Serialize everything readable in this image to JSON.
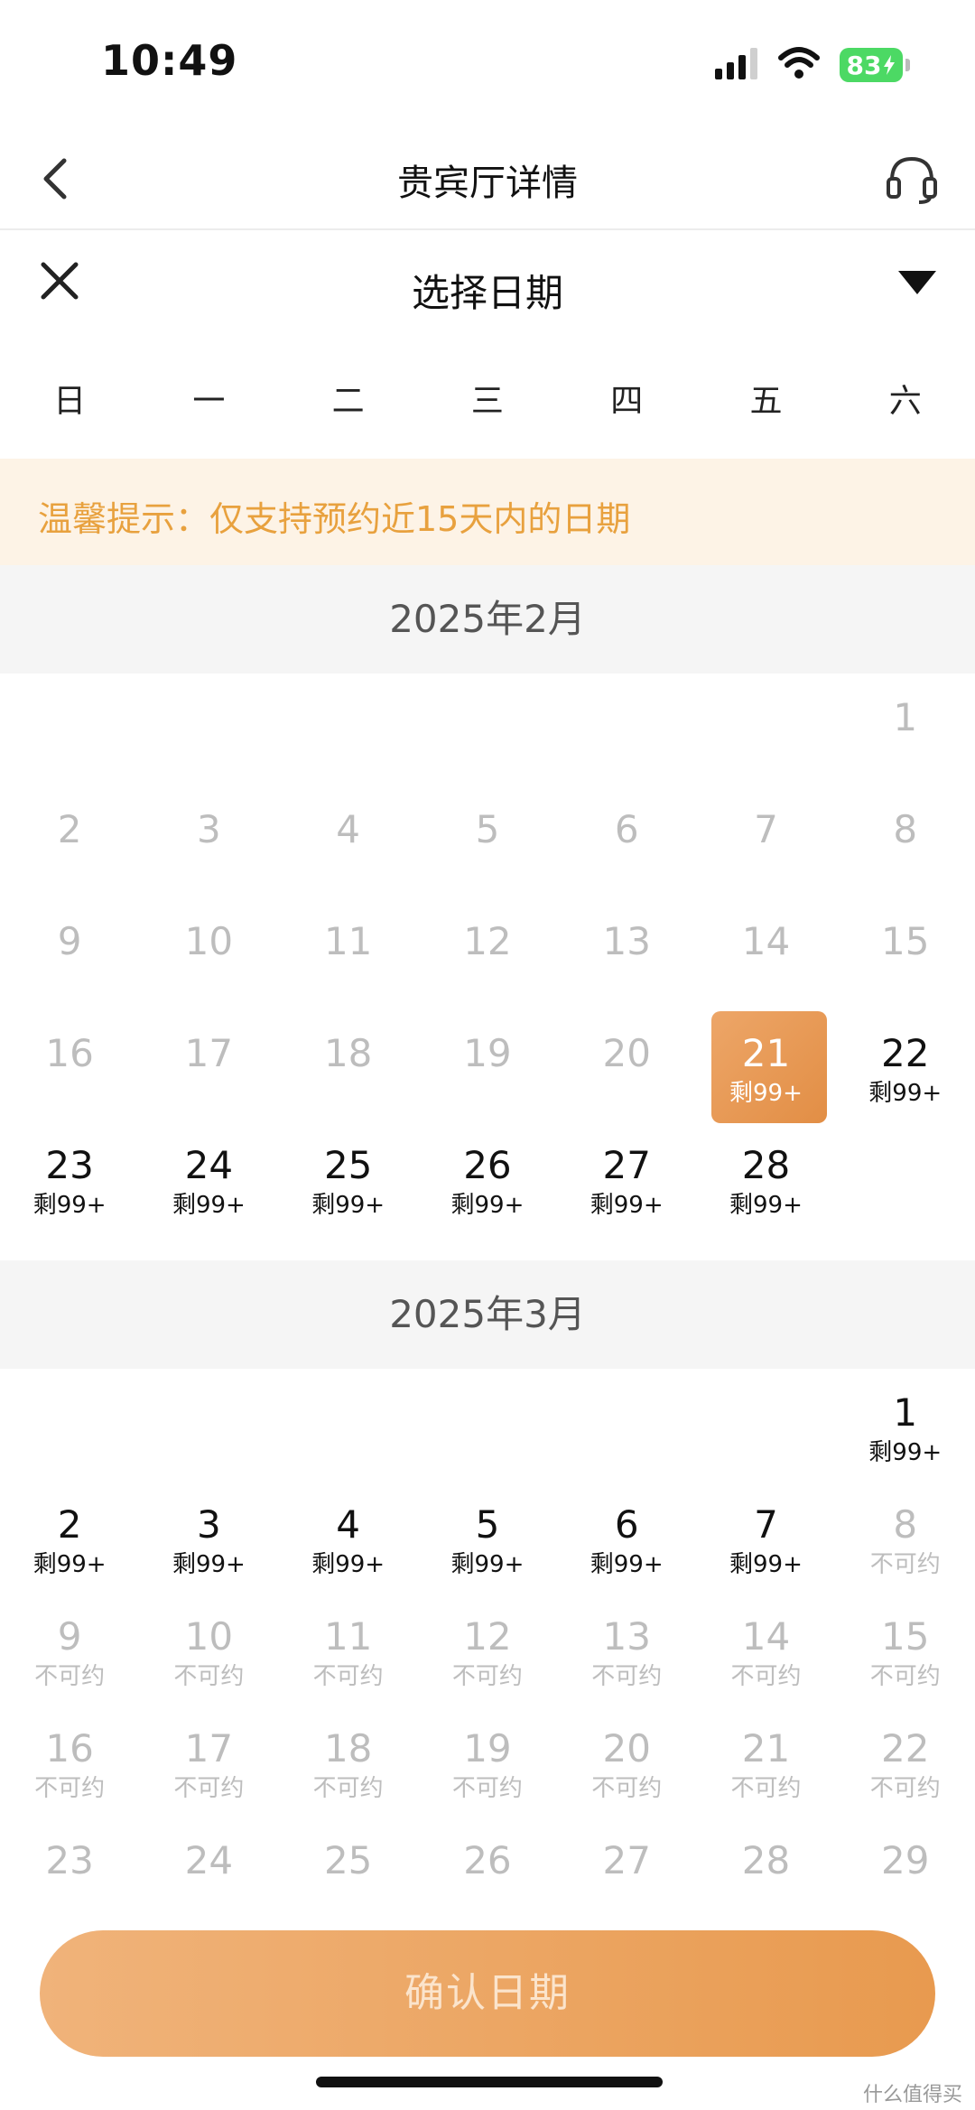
{
  "status_bar": {
    "time": "10:49",
    "battery": "83"
  },
  "header": {
    "title": "贵宾厅详情"
  },
  "picker": {
    "title": "选择日期"
  },
  "weekdays": [
    "日",
    "一",
    "二",
    "三",
    "四",
    "五",
    "六"
  ],
  "notice": {
    "text": "温馨提示：仅支持预约近15天内的日期"
  },
  "months": [
    {
      "label": "2025年2月",
      "rows": [
        [
          {
            "d": "",
            "s": "",
            "st": "empty"
          },
          {
            "d": "",
            "s": "",
            "st": "empty"
          },
          {
            "d": "",
            "s": "",
            "st": "empty"
          },
          {
            "d": "",
            "s": "",
            "st": "empty"
          },
          {
            "d": "",
            "s": "",
            "st": "empty"
          },
          {
            "d": "",
            "s": "",
            "st": "empty"
          },
          {
            "d": "1",
            "s": "",
            "st": "disabled"
          }
        ],
        [
          {
            "d": "2",
            "s": "",
            "st": "disabled"
          },
          {
            "d": "3",
            "s": "",
            "st": "disabled"
          },
          {
            "d": "4",
            "s": "",
            "st": "disabled"
          },
          {
            "d": "5",
            "s": "",
            "st": "disabled"
          },
          {
            "d": "6",
            "s": "",
            "st": "disabled"
          },
          {
            "d": "7",
            "s": "",
            "st": "disabled"
          },
          {
            "d": "8",
            "s": "",
            "st": "disabled"
          }
        ],
        [
          {
            "d": "9",
            "s": "",
            "st": "disabled"
          },
          {
            "d": "10",
            "s": "",
            "st": "disabled"
          },
          {
            "d": "11",
            "s": "",
            "st": "disabled"
          },
          {
            "d": "12",
            "s": "",
            "st": "disabled"
          },
          {
            "d": "13",
            "s": "",
            "st": "disabled"
          },
          {
            "d": "14",
            "s": "",
            "st": "disabled"
          },
          {
            "d": "15",
            "s": "",
            "st": "disabled"
          }
        ],
        [
          {
            "d": "16",
            "s": "",
            "st": "disabled"
          },
          {
            "d": "17",
            "s": "",
            "st": "disabled"
          },
          {
            "d": "18",
            "s": "",
            "st": "disabled"
          },
          {
            "d": "19",
            "s": "",
            "st": "disabled"
          },
          {
            "d": "20",
            "s": "",
            "st": "disabled"
          },
          {
            "d": "21",
            "s": "剩99+",
            "st": "selected"
          },
          {
            "d": "22",
            "s": "剩99+",
            "st": "available"
          }
        ],
        [
          {
            "d": "23",
            "s": "剩99+",
            "st": "available"
          },
          {
            "d": "24",
            "s": "剩99+",
            "st": "available"
          },
          {
            "d": "25",
            "s": "剩99+",
            "st": "available"
          },
          {
            "d": "26",
            "s": "剩99+",
            "st": "available"
          },
          {
            "d": "27",
            "s": "剩99+",
            "st": "available"
          },
          {
            "d": "28",
            "s": "剩99+",
            "st": "available"
          },
          {
            "d": "",
            "s": "",
            "st": "empty"
          }
        ]
      ]
    },
    {
      "label": "2025年3月",
      "rows": [
        [
          {
            "d": "",
            "s": "",
            "st": "empty"
          },
          {
            "d": "",
            "s": "",
            "st": "empty"
          },
          {
            "d": "",
            "s": "",
            "st": "empty"
          },
          {
            "d": "",
            "s": "",
            "st": "empty"
          },
          {
            "d": "",
            "s": "",
            "st": "empty"
          },
          {
            "d": "",
            "s": "",
            "st": "empty"
          },
          {
            "d": "1",
            "s": "剩99+",
            "st": "available"
          }
        ],
        [
          {
            "d": "2",
            "s": "剩99+",
            "st": "available"
          },
          {
            "d": "3",
            "s": "剩99+",
            "st": "available"
          },
          {
            "d": "4",
            "s": "剩99+",
            "st": "available"
          },
          {
            "d": "5",
            "s": "剩99+",
            "st": "available"
          },
          {
            "d": "6",
            "s": "剩99+",
            "st": "available"
          },
          {
            "d": "7",
            "s": "剩99+",
            "st": "available"
          },
          {
            "d": "8",
            "s": "不可约",
            "st": "disabled"
          }
        ],
        [
          {
            "d": "9",
            "s": "不可约",
            "st": "disabled"
          },
          {
            "d": "10",
            "s": "不可约",
            "st": "disabled"
          },
          {
            "d": "11",
            "s": "不可约",
            "st": "disabled"
          },
          {
            "d": "12",
            "s": "不可约",
            "st": "disabled"
          },
          {
            "d": "13",
            "s": "不可约",
            "st": "disabled"
          },
          {
            "d": "14",
            "s": "不可约",
            "st": "disabled"
          },
          {
            "d": "15",
            "s": "不可约",
            "st": "disabled"
          }
        ],
        [
          {
            "d": "16",
            "s": "不可约",
            "st": "disabled"
          },
          {
            "d": "17",
            "s": "不可约",
            "st": "disabled"
          },
          {
            "d": "18",
            "s": "不可约",
            "st": "disabled"
          },
          {
            "d": "19",
            "s": "不可约",
            "st": "disabled"
          },
          {
            "d": "20",
            "s": "不可约",
            "st": "disabled"
          },
          {
            "d": "21",
            "s": "不可约",
            "st": "disabled"
          },
          {
            "d": "22",
            "s": "不可约",
            "st": "disabled"
          }
        ],
        [
          {
            "d": "23",
            "s": "",
            "st": "disabled"
          },
          {
            "d": "24",
            "s": "",
            "st": "disabled"
          },
          {
            "d": "25",
            "s": "",
            "st": "disabled"
          },
          {
            "d": "26",
            "s": "",
            "st": "disabled"
          },
          {
            "d": "27",
            "s": "",
            "st": "disabled"
          },
          {
            "d": "28",
            "s": "",
            "st": "disabled"
          },
          {
            "d": "29",
            "s": "",
            "st": "disabled"
          }
        ]
      ]
    }
  ],
  "confirm": {
    "label": "确认日期"
  },
  "watermark": "什么值得买",
  "colors": {
    "accent": "#e89a4f",
    "notice_text": "#e8a13e",
    "notice_bg": "#fdf3e6",
    "disabled": "#bdbdbd"
  },
  "icons": {
    "back": "chevron-left-icon",
    "service": "headset-icon",
    "close": "close-icon",
    "dropdown": "triangle-down-icon",
    "wifi": "wifi-icon",
    "signal": "signal-icon",
    "battery": "battery-icon"
  }
}
